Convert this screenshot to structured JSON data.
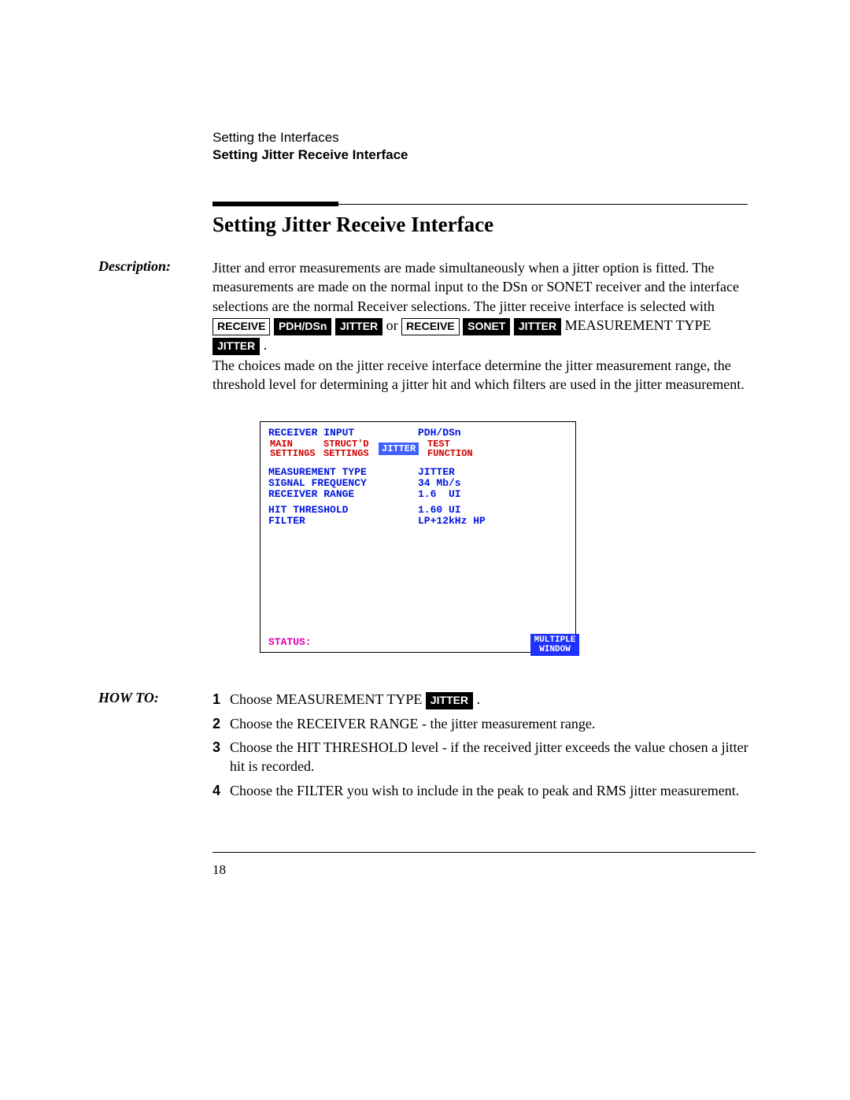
{
  "header": {
    "chapter": "Setting the Interfaces",
    "section": "Setting Jitter Receive Interface"
  },
  "title": "Setting Jitter Receive Interface",
  "labels": {
    "description": "Description:",
    "howto": "HOW TO:"
  },
  "desc": {
    "p1a": "Jitter and error measurements are made simultaneously when a jitter option is fitted. The measurements are made on the normal input to the DSn or SONET receiver and the interface selections are the normal Receiver selections. The jitter receive interface is selected with ",
    "key_receive": "RECEIVE",
    "key_pdhdsn": "PDH/DSn",
    "key_jitter": "JITTER",
    "or": " or ",
    "key_sonet": "SONET",
    "meas_type": " MEASUREMENT TYPE ",
    "period": " .",
    "p2": "The choices made on the jitter receive interface determine the jitter measurement range, the threshold level for determining a jitter hit and which filters are used in the jitter measurement."
  },
  "screen": {
    "receiver_input_label": "RECEIVER INPUT",
    "receiver_input_value": "PDH/DSn",
    "tabs": {
      "main": "MAIN\nSETTINGS",
      "structd": "STRUCT'D\nSETTINGS",
      "jitter": "JITTER",
      "test": "TEST\nFUNCTION"
    },
    "fields": {
      "measurement_type_label": "MEASUREMENT TYPE",
      "measurement_type_value": "JITTER",
      "signal_frequency_label": "SIGNAL FREQUENCY",
      "signal_frequency_value": "34 Mb/s",
      "receiver_range_label": "RECEIVER RANGE",
      "receiver_range_value": "1.6  UI",
      "hit_threshold_label": "HIT THRESHOLD",
      "hit_threshold_value": "1.60 UI",
      "filter_label": "FILTER",
      "filter_value": "LP+12kHz HP"
    },
    "status_label": "STATUS:",
    "softkey": "MULTIPLE\nWINDOW"
  },
  "steps": [
    {
      "num": "1",
      "pre": "Choose MEASUREMENT TYPE ",
      "key": "JITTER",
      "post": " ."
    },
    {
      "num": "2",
      "text": "Choose the RECEIVER RANGE - the jitter measurement range."
    },
    {
      "num": "3",
      "text": "Choose the HIT THRESHOLD level - if the received jitter exceeds the value chosen a jitter hit is recorded."
    },
    {
      "num": "4",
      "text": "Choose the FILTER you wish to include in the peak to peak and RMS jitter measurement."
    }
  ],
  "page_number": "18"
}
